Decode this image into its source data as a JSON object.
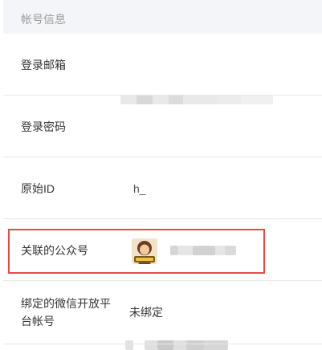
{
  "section": {
    "title": "帐号信息"
  },
  "rows": [
    {
      "label": "登录邮箱",
      "value": ""
    },
    {
      "label": "登录密码",
      "value": ""
    },
    {
      "label": "原始ID",
      "value": "h_"
    },
    {
      "label": "关联的公众号",
      "value": ""
    },
    {
      "label_line1": "绑定的微信开放平",
      "label_line2": "台帐号",
      "value": "未绑定"
    }
  ],
  "colors": {
    "header_bg": "#f4f5f9",
    "separator": "#e7e7eb",
    "highlight_border": "#e84a4a",
    "muted_text": "#9a9a9a"
  }
}
